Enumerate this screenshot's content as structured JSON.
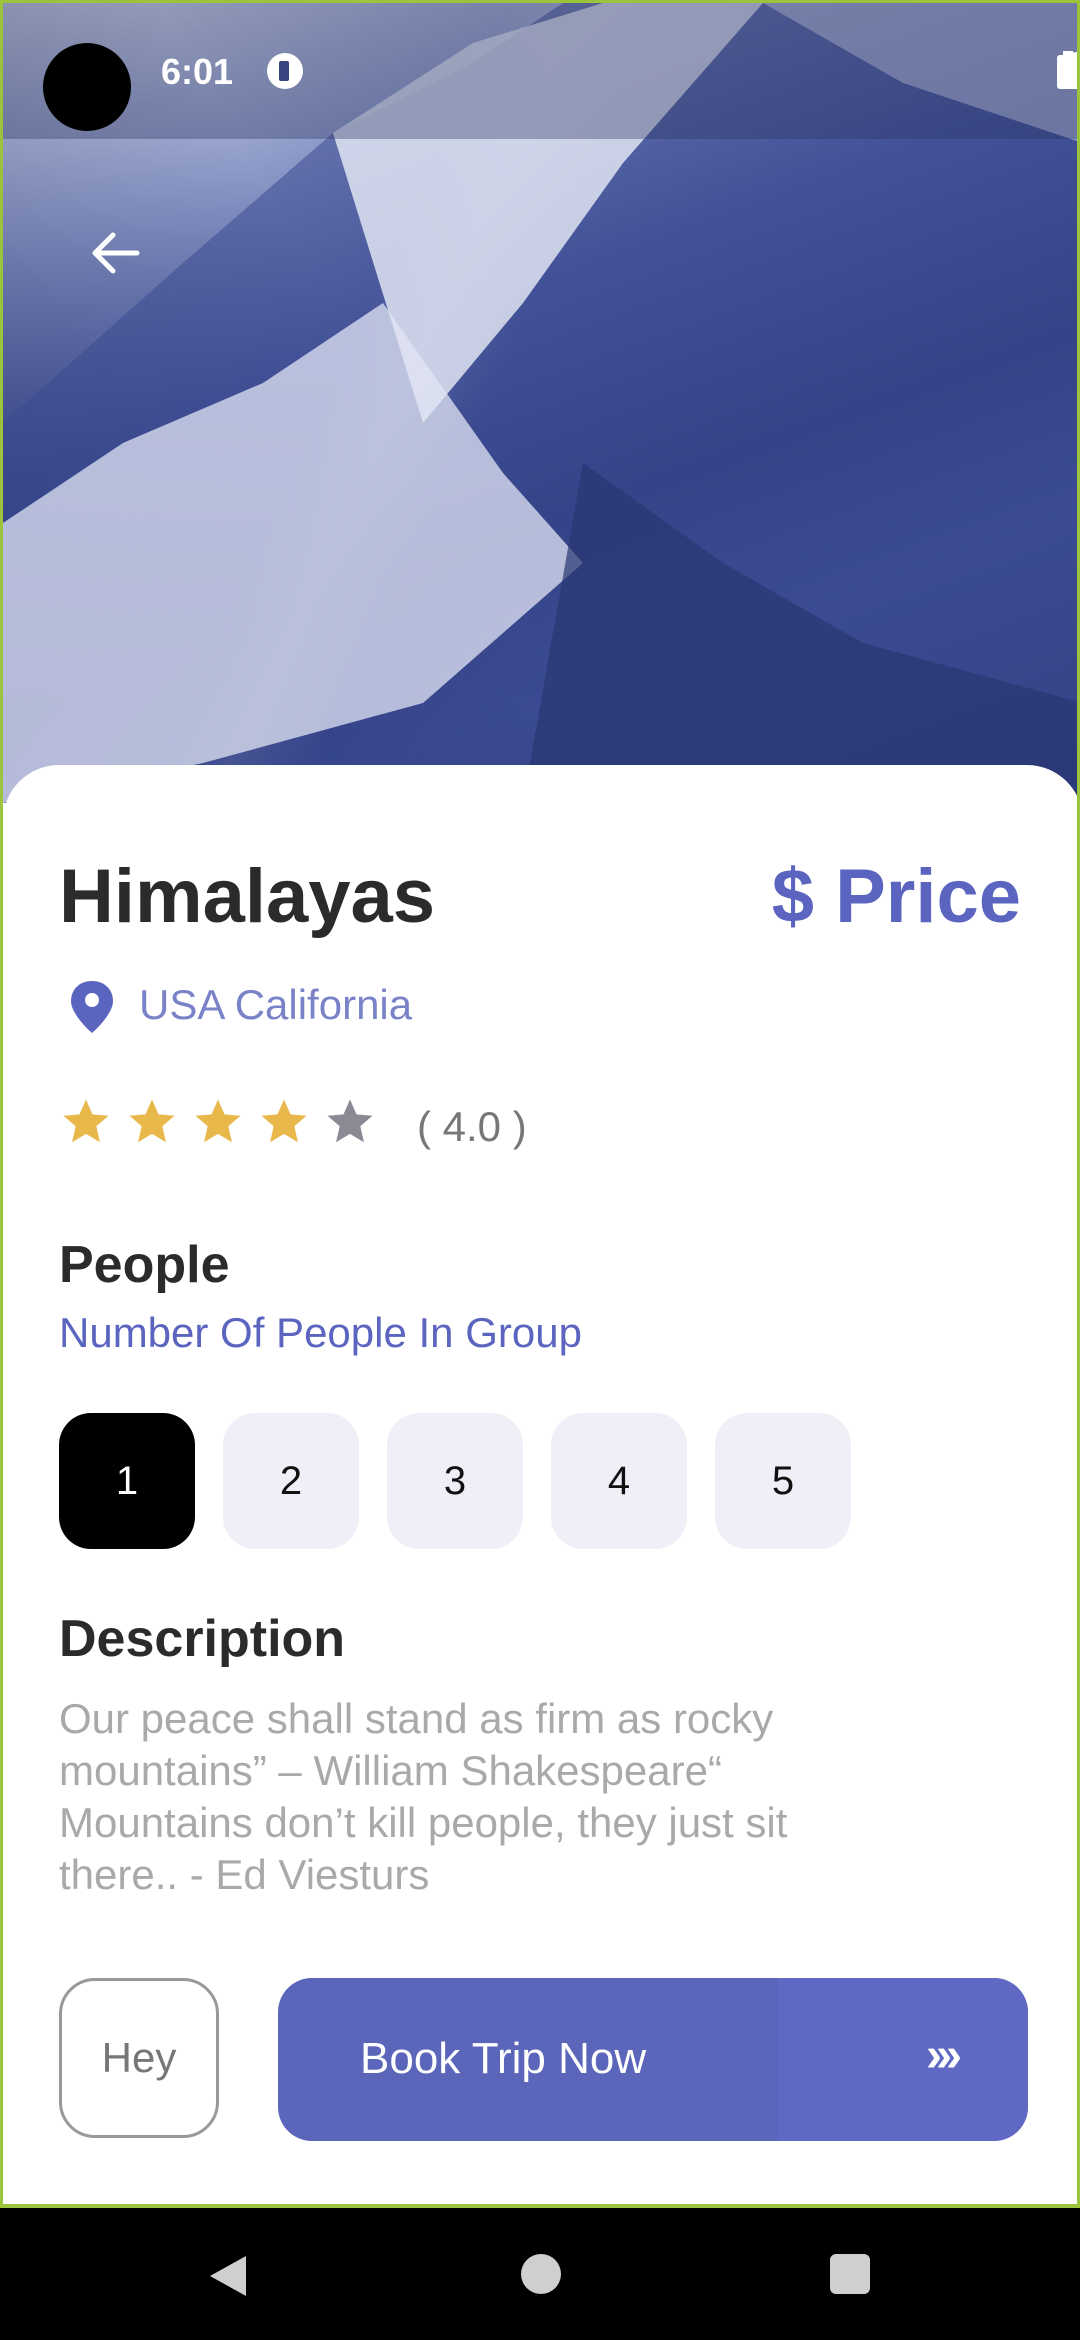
{
  "status_bar": {
    "time": "6:01"
  },
  "destination": {
    "title": "Himalayas",
    "price": "$ Price",
    "location": "USA California",
    "rating": 4.0,
    "rating_text": "( 4.0 )",
    "stars_filled": 4,
    "stars_total": 5
  },
  "people": {
    "title": "People",
    "subtitle": "Number Of People In Group",
    "options": [
      "1",
      "2",
      "3",
      "4",
      "5"
    ],
    "selected": "1"
  },
  "description": {
    "title": "Description",
    "text": "Our peace shall stand as firm as rocky mountains” – William Shakespeare“ Mountains don’t kill people, they just sit there.. - Ed Viesturs"
  },
  "actions": {
    "hey_label": "Hey",
    "book_label": "Book Trip Now",
    "book_arrows": "›››"
  },
  "colors": {
    "accent": "#5b65c0",
    "star_filled": "#e8b84a",
    "star_empty": "#8a8a95",
    "frame_border": "#9bc33b"
  },
  "icons": {
    "back": "arrow-left-icon",
    "location": "location-pin-icon",
    "wifi": "wifi-icon",
    "signal": "signal-icon",
    "battery": "battery-icon"
  }
}
